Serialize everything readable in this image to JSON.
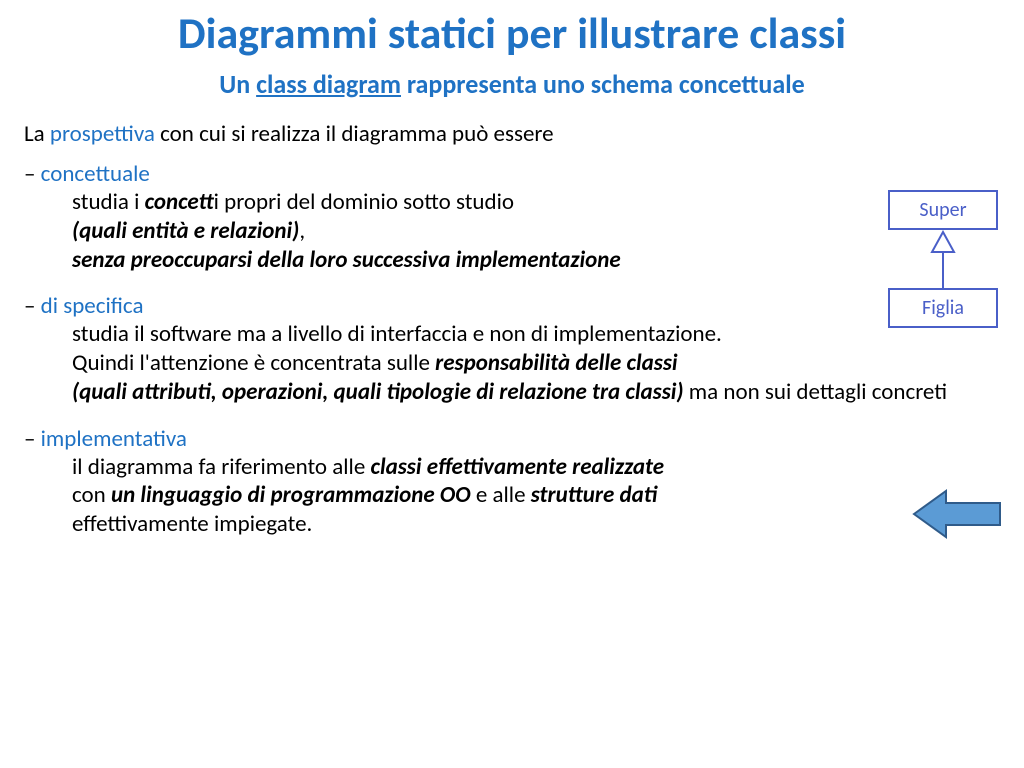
{
  "title": "Diagrammi statici per illustrare classi",
  "subtitle": {
    "pre": "Un ",
    "link": "class diagram",
    "post": " rappresenta uno schema concettuale"
  },
  "intro": {
    "pre": "La ",
    "kw": "prospettiva",
    "post": " con cui si realizza il diagramma può essere"
  },
  "sections": {
    "conc": {
      "name": "concettuale",
      "l1a": "studia i ",
      "l1b": "concett",
      "l1c": "i propri del dominio sotto studio",
      "l2": "(quali entità e relazioni)",
      "l3": "senza preoccuparsi della loro successiva implementazione"
    },
    "spec": {
      "name": "di specifica",
      "l1": "studia il software ma a livello di interfaccia e non di implementazione.",
      "l2a": "Quindi l'attenzione è concentrata sulle ",
      "l2b": "responsabilità delle classi",
      "l3a": "(quali attributi,  operazioni, quali tipologie di relazione tra classi)",
      "l3b": " ma non sui dettagli concreti"
    },
    "impl": {
      "name": "implementativa",
      "l1a": "il diagramma fa riferimento alle ",
      "l1b": "classi effettivamente realizzate",
      "l2a": "con ",
      "l2b": "un linguaggio di programmazione OO",
      "l2c": " e alle  ",
      "l2d": "strutture dati",
      "l3": "effettivamente impiegate."
    }
  },
  "uml": {
    "super": "Super",
    "figlia": "Figlia"
  },
  "dash": "– "
}
